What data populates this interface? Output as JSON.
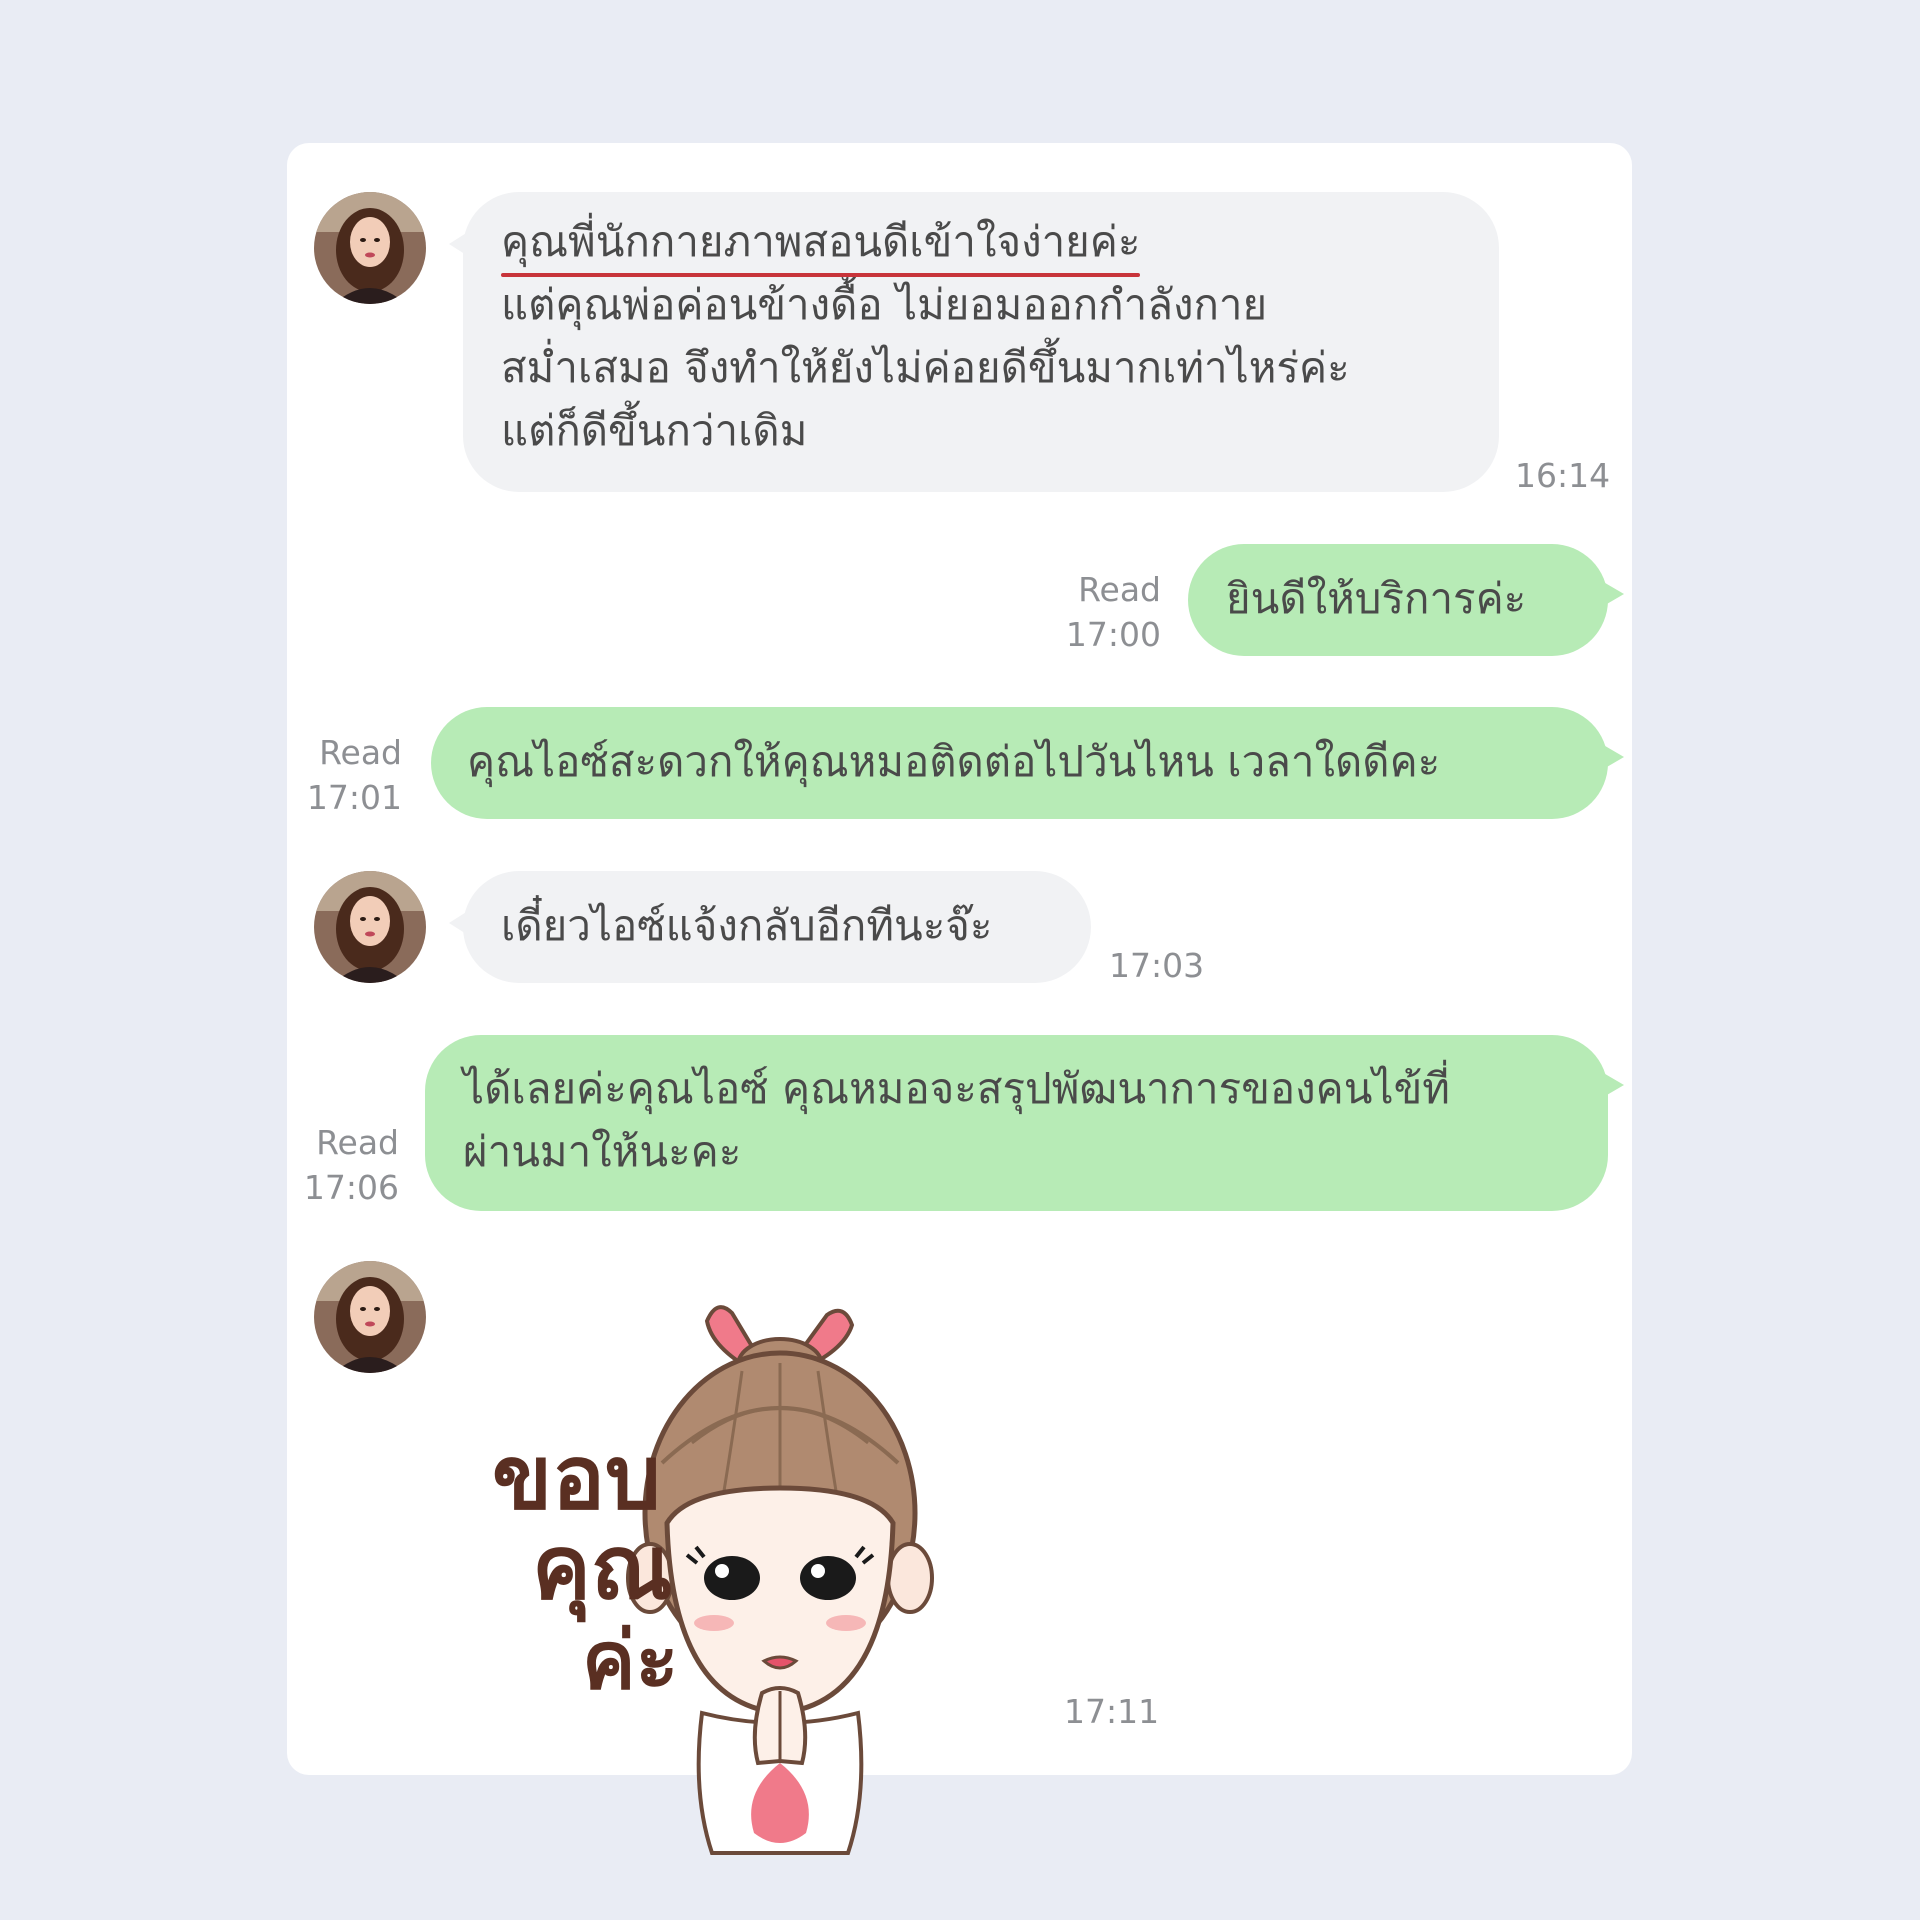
{
  "messages": [
    {
      "side": "incoming",
      "lines": [
        "คุณพี่นักกายภาพสอนดีเข้าใจง่ายค่ะ",
        "แต่คุณพ่อค่อนข้างดื้อ ไม่ยอมออกกำลังกาย",
        "สม่ำเสมอ จึงทำให้ยังไม่ค่อยดีขึ้นมากเท่าไหร่ค่ะ",
        "แต่ก็ดีขึ้นกว่าเดิม"
      ],
      "time": "16:14"
    },
    {
      "side": "outgoing",
      "lines": [
        "ยินดีให้บริการค่ะ"
      ],
      "status": "Read",
      "time": "17:00"
    },
    {
      "side": "outgoing",
      "lines": [
        "คุณไอซ์สะดวกให้คุณหมอติดต่อไปวันไหน เวลาใดดีคะ"
      ],
      "status": "Read",
      "time": "17:01"
    },
    {
      "side": "incoming",
      "lines": [
        "เดี๋ยวไอซ์แจ้งกลับอีกทีนะจ๊ะ"
      ],
      "time": "17:03"
    },
    {
      "side": "outgoing",
      "lines": [
        "ได้เลยค่ะคุณไอซ์ คุณหมอจะสรุปพัฒนาการของคนไข้ที่",
        "ผ่านมาให้นะคะ"
      ],
      "status": "Read",
      "time": "17:06"
    },
    {
      "side": "incoming",
      "type": "sticker",
      "sticker_text": [
        "ขอบ",
        "คุณ",
        "ค่ะ"
      ],
      "time": "17:11"
    }
  ],
  "colors": {
    "background": "#e9ecf4",
    "card": "#ffffff",
    "incoming_bubble": "#f1f2f4",
    "outgoing_bubble": "#b7ebb6",
    "underline": "#c8343a",
    "meta_text": "#8d8f93"
  },
  "icons": {
    "avatar": "contact-avatar-photo",
    "sticker": "girl-thank-you-sticker"
  }
}
